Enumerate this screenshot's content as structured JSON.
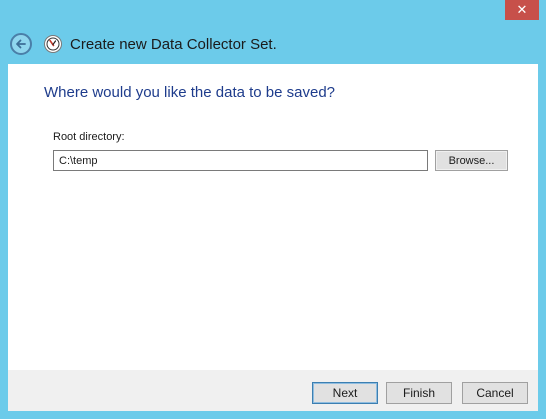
{
  "window": {
    "close_glyph": "✕",
    "title": "Create new Data Collector Set."
  },
  "page": {
    "question": "Where would you like the data to be saved?",
    "root_label": "Root directory:",
    "root_value": "C:\\temp",
    "browse_label": "Browse..."
  },
  "footer": {
    "next_label": "Next",
    "finish_label": "Finish",
    "cancel_label": "Cancel"
  },
  "icons": {
    "back": "back-arrow-icon",
    "app": "performance-monitor-icon"
  }
}
